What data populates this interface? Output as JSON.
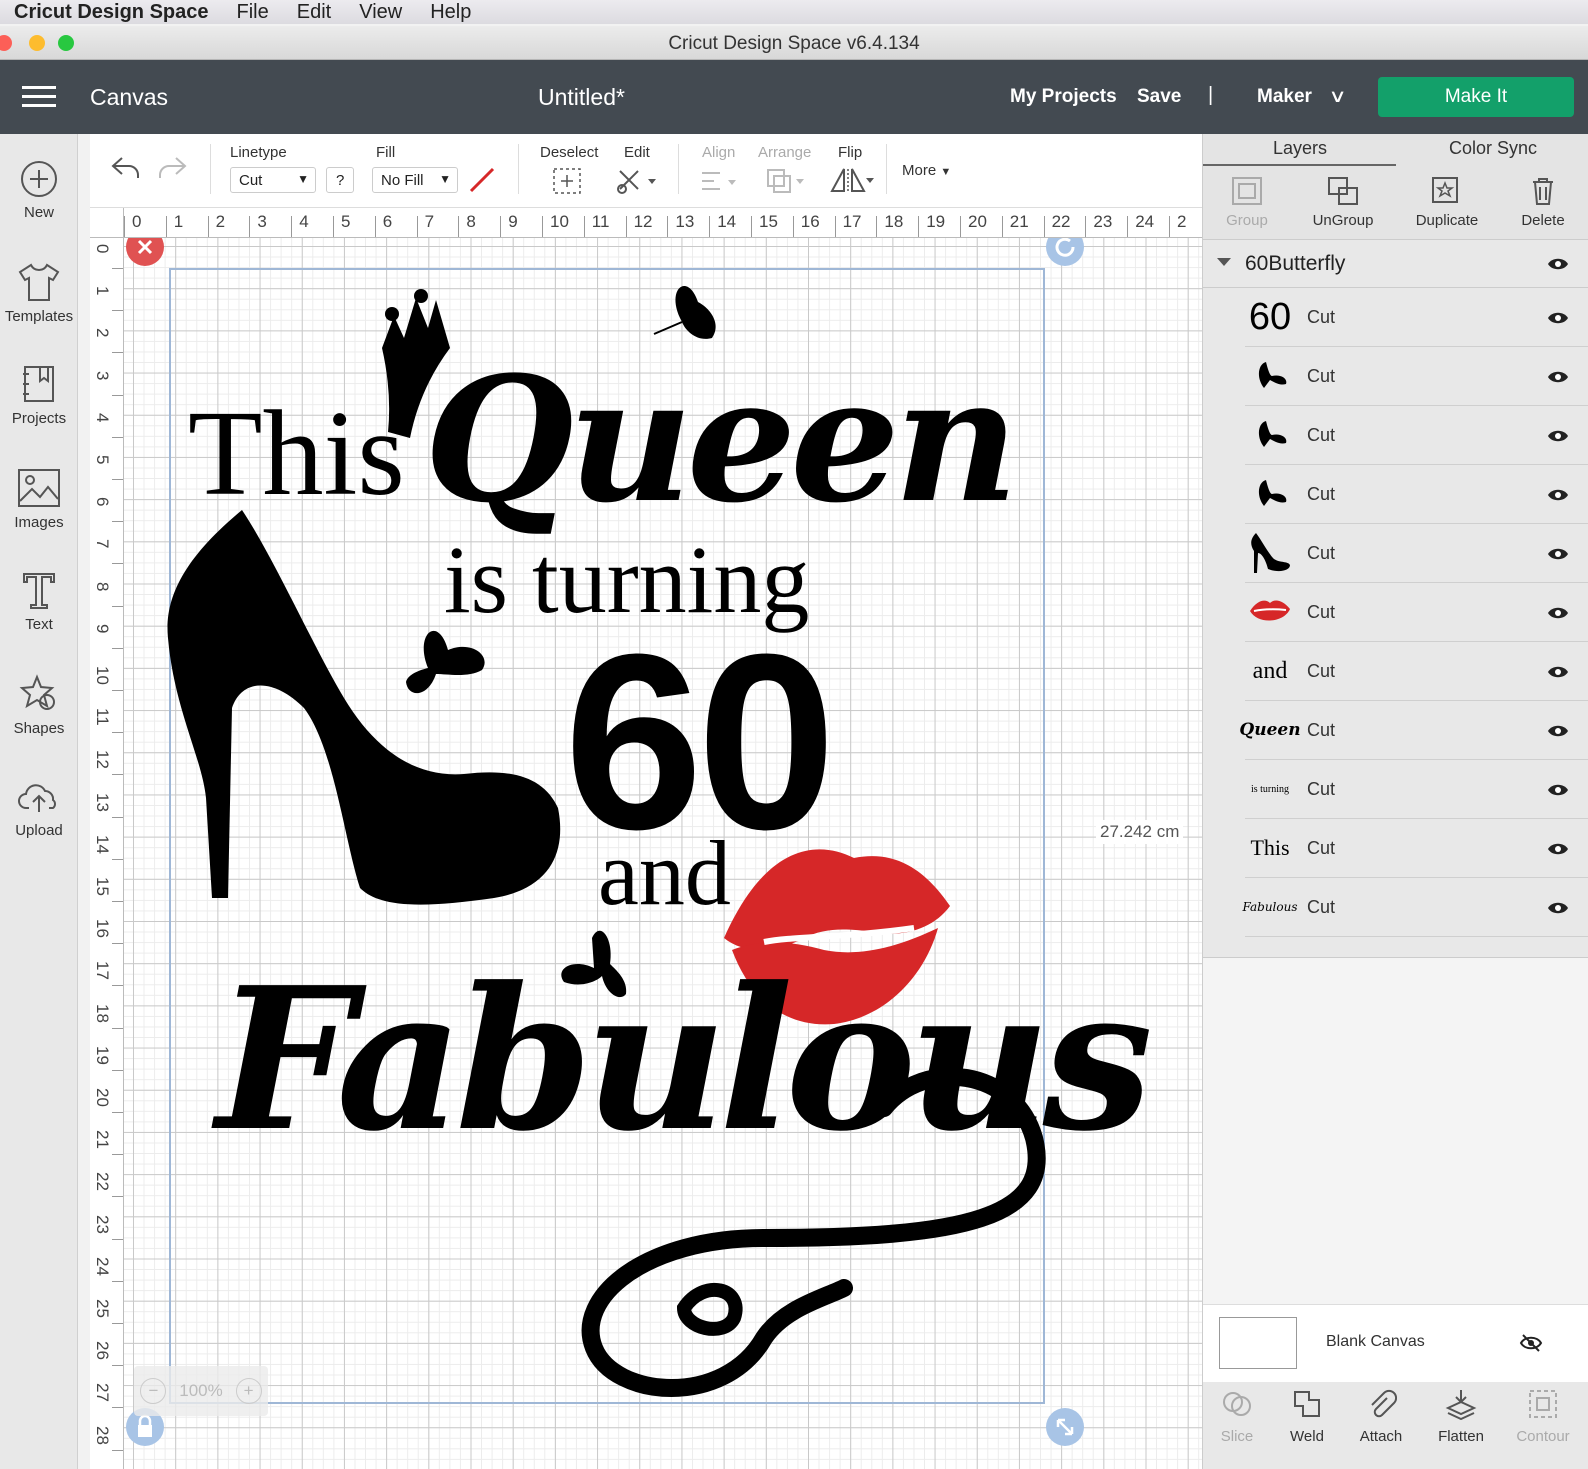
{
  "menubar": {
    "app": "Cricut Design Space",
    "items": [
      "File",
      "Edit",
      "View",
      "Help"
    ]
  },
  "window": {
    "title": "Cricut Design Space  v6.4.134"
  },
  "header": {
    "canvas_label": "Canvas",
    "document_title": "Untitled*",
    "my_projects": "My Projects",
    "save": "Save",
    "separator": "|",
    "machine": "Maker",
    "make_it": "Make It",
    "make_it_color": "#13a06a"
  },
  "leftnav": [
    {
      "label": "New",
      "icon": "plus-circle-icon"
    },
    {
      "label": "Templates",
      "icon": "tshirt-icon"
    },
    {
      "label": "Projects",
      "icon": "projects-icon"
    },
    {
      "label": "Images",
      "icon": "image-icon"
    },
    {
      "label": "Text",
      "icon": "text-icon"
    },
    {
      "label": "Shapes",
      "icon": "shapes-icon"
    },
    {
      "label": "Upload",
      "icon": "cloud-upload-icon"
    }
  ],
  "toolbar": {
    "linetype_label": "Linetype",
    "linetype_value": "Cut",
    "help": "?",
    "fill_label": "Fill",
    "fill_value": "No Fill",
    "deselect": "Deselect",
    "edit": "Edit",
    "align": "Align",
    "arrange": "Arrange",
    "flip": "Flip",
    "more": "More"
  },
  "ruler": {
    "h": [
      "0",
      "1",
      "2",
      "3",
      "4",
      "5",
      "6",
      "7",
      "8",
      "9",
      "10",
      "11",
      "12",
      "13",
      "14",
      "15",
      "16",
      "17",
      "18",
      "19",
      "20",
      "21",
      "22",
      "23",
      "24",
      "2"
    ],
    "v": [
      "0",
      "1",
      "2",
      "3",
      "4",
      "5",
      "6",
      "7",
      "8",
      "9",
      "10",
      "11",
      "12",
      "13",
      "14",
      "15",
      "16",
      "17",
      "18",
      "19",
      "20",
      "21",
      "22",
      "23",
      "24",
      "25",
      "26",
      "27",
      "28"
    ]
  },
  "canvas": {
    "height_label": "27.242 cm",
    "zoom": "100%",
    "design": {
      "this": "This",
      "queen": "Queen",
      "is_turning": "is turning",
      "number": "60",
      "and": "and",
      "fabulous": "Fabulous",
      "lips_color": "#d62728"
    }
  },
  "panel": {
    "tabs": [
      "Layers",
      "Color Sync"
    ],
    "actions": [
      {
        "label": "Group",
        "icon": "group-icon",
        "enabled": false
      },
      {
        "label": "UnGroup",
        "icon": "ungroup-icon",
        "enabled": true
      },
      {
        "label": "Duplicate",
        "icon": "duplicate-icon",
        "enabled": true
      },
      {
        "label": "Delete",
        "icon": "trash-icon",
        "enabled": true
      }
    ],
    "group_name": "60Butterfly",
    "layers": [
      {
        "thumb": "60",
        "type": "Cut"
      },
      {
        "thumb": "butterfly",
        "type": "Cut"
      },
      {
        "thumb": "butterfly",
        "type": "Cut"
      },
      {
        "thumb": "butterfly",
        "type": "Cut"
      },
      {
        "thumb": "shoe",
        "type": "Cut"
      },
      {
        "thumb": "lips",
        "type": "Cut"
      },
      {
        "thumb": "and",
        "type": "Cut"
      },
      {
        "thumb": "Queen",
        "type": "Cut"
      },
      {
        "thumb": "is turning",
        "type": "Cut"
      },
      {
        "thumb": "This",
        "type": "Cut"
      },
      {
        "thumb": "Fabulous",
        "type": "Cut"
      }
    ],
    "blank_canvas": "Blank Canvas",
    "bottom_actions": [
      {
        "label": "Slice",
        "icon": "slice-icon",
        "enabled": false
      },
      {
        "label": "Weld",
        "icon": "weld-icon",
        "enabled": true
      },
      {
        "label": "Attach",
        "icon": "paperclip-icon",
        "enabled": true
      },
      {
        "label": "Flatten",
        "icon": "flatten-icon",
        "enabled": true
      },
      {
        "label": "Contour",
        "icon": "contour-icon",
        "enabled": false
      }
    ]
  }
}
